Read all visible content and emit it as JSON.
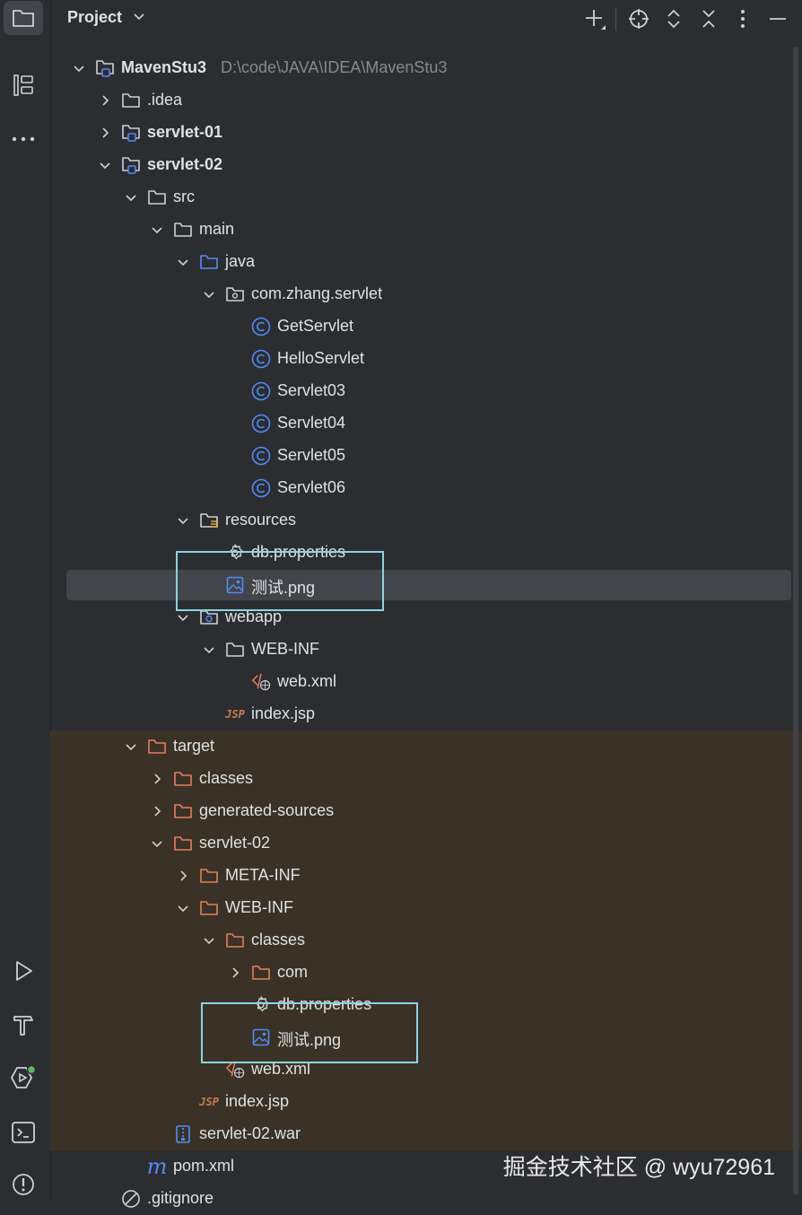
{
  "header": {
    "title": "Project"
  },
  "project": {
    "name": "MavenStu3",
    "path": "D:\\code\\JAVA\\IDEA\\MavenStu3"
  },
  "tree": [
    {
      "label": "MavenStu3",
      "depth": 0,
      "expanded": true,
      "icon": "module-folder-icon",
      "bold": true
    },
    {
      "label": ".idea",
      "depth": 1,
      "expanded": false,
      "icon": "folder-icon"
    },
    {
      "label": "servlet-01",
      "depth": 1,
      "expanded": false,
      "icon": "module-folder-icon",
      "bold": true
    },
    {
      "label": "servlet-02",
      "depth": 1,
      "expanded": true,
      "icon": "module-folder-icon",
      "bold": true
    },
    {
      "label": "src",
      "depth": 2,
      "expanded": true,
      "icon": "folder-icon"
    },
    {
      "label": "main",
      "depth": 3,
      "expanded": true,
      "icon": "folder-icon"
    },
    {
      "label": "java",
      "depth": 4,
      "expanded": true,
      "icon": "source-folder-icon"
    },
    {
      "label": "com.zhang.servlet",
      "depth": 5,
      "expanded": true,
      "icon": "package-icon"
    },
    {
      "label": "GetServlet",
      "depth": 6,
      "icon": "class-icon"
    },
    {
      "label": "HelloServlet",
      "depth": 6,
      "icon": "class-icon"
    },
    {
      "label": "Servlet03",
      "depth": 6,
      "icon": "class-icon"
    },
    {
      "label": "Servlet04",
      "depth": 6,
      "icon": "class-icon"
    },
    {
      "label": "Servlet05",
      "depth": 6,
      "icon": "class-icon"
    },
    {
      "label": "Servlet06",
      "depth": 6,
      "icon": "class-icon"
    },
    {
      "label": "resources",
      "depth": 4,
      "expanded": true,
      "icon": "resources-folder-icon"
    },
    {
      "label": "db.properties",
      "depth": 5,
      "icon": "properties-file-icon"
    },
    {
      "label": "测试.png",
      "depth": 5,
      "icon": "image-file-icon",
      "selected": true
    },
    {
      "label": "webapp",
      "depth": 4,
      "expanded": true,
      "icon": "web-folder-icon"
    },
    {
      "label": "WEB-INF",
      "depth": 5,
      "expanded": true,
      "icon": "folder-icon"
    },
    {
      "label": "web.xml",
      "depth": 6,
      "icon": "xml-file-icon"
    },
    {
      "label": "index.jsp",
      "depth": 5,
      "icon": "jsp-file-icon"
    },
    {
      "label": "target",
      "depth": 2,
      "expanded": true,
      "icon": "excluded-folder-icon"
    },
    {
      "label": "classes",
      "depth": 3,
      "expanded": false,
      "icon": "excluded-folder-icon"
    },
    {
      "label": "generated-sources",
      "depth": 3,
      "expanded": false,
      "icon": "excluded-folder-icon"
    },
    {
      "label": "servlet-02",
      "depth": 3,
      "expanded": true,
      "icon": "excluded-folder-icon"
    },
    {
      "label": "META-INF",
      "depth": 4,
      "expanded": false,
      "icon": "excluded-folder-icon"
    },
    {
      "label": "WEB-INF",
      "depth": 4,
      "expanded": true,
      "icon": "excluded-folder-icon"
    },
    {
      "label": "classes",
      "depth": 5,
      "expanded": true,
      "icon": "excluded-folder-icon"
    },
    {
      "label": "com",
      "depth": 6,
      "expanded": false,
      "icon": "excluded-folder-icon"
    },
    {
      "label": "db.properties",
      "depth": 6,
      "icon": "properties-file-icon"
    },
    {
      "label": "测试.png",
      "depth": 6,
      "icon": "image-file-icon"
    },
    {
      "label": "web.xml",
      "depth": 5,
      "icon": "xml-file-icon"
    },
    {
      "label": "index.jsp",
      "depth": 4,
      "icon": "jsp-file-icon"
    },
    {
      "label": "servlet-02.war",
      "depth": 3,
      "icon": "war-file-icon"
    },
    {
      "label": "pom.xml",
      "depth": 2,
      "icon": "maven-file-icon"
    },
    {
      "label": ".gitignore",
      "depth": 1,
      "icon": "ignored-file-icon"
    }
  ],
  "watermark": "掘金技术社区 @ wyu72961",
  "colors": {
    "background": "#2b2d30",
    "selection": "#43454a",
    "excluded_tint": "#3a3226",
    "accent": "#548af7",
    "highlight_box": "#8ad4e2"
  }
}
